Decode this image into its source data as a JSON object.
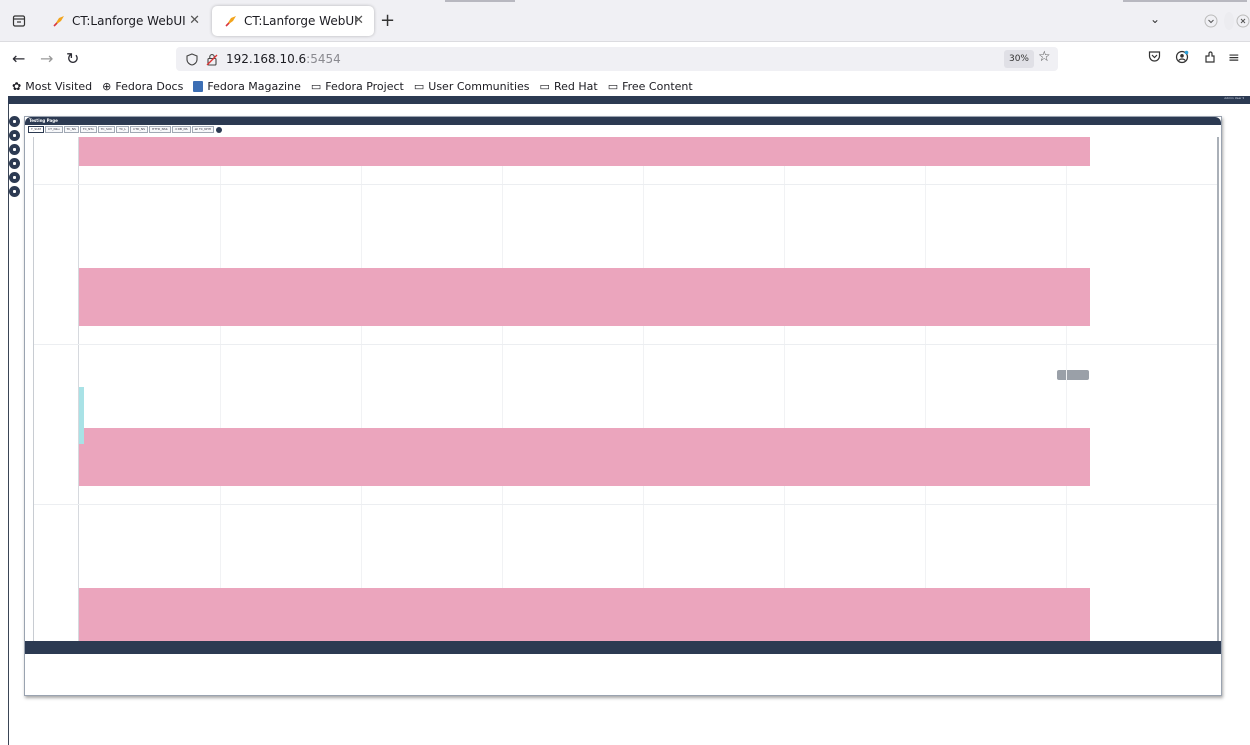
{
  "browser": {
    "tabs": [
      {
        "title": "CT:Lanforge WebUI",
        "active": false
      },
      {
        "title": "CT:Lanforge WebUI",
        "active": true
      }
    ],
    "new_tab": "+",
    "url_host": "192.168.10.6",
    "url_port": ":5454",
    "zoom": "30%",
    "bookmarks": [
      {
        "label": "Most Visited",
        "icon": "gear-icon"
      },
      {
        "label": "Fedora Docs",
        "icon": "globe-icon"
      },
      {
        "label": "Fedora Magazine",
        "icon": "magazine-icon"
      },
      {
        "label": "Fedora Project",
        "icon": "folder-icon"
      },
      {
        "label": "User Communities",
        "icon": "folder-icon"
      },
      {
        "label": "Red Hat",
        "icon": "folder-icon"
      },
      {
        "label": "Free Content",
        "icon": "folder-icon"
      }
    ]
  },
  "page": {
    "user_label": "Admin User ▾",
    "panel_title": "Testing Page",
    "subtabs": [
      "T_SUM",
      "CT_Nbu",
      "TC_NS",
      "TC_NTu",
      "TC_SUC",
      "TC_L",
      "CTD_NS",
      "HTTD_NSb",
      "d DB_NS",
      "all TC_NHH"
    ],
    "tooltip_lines": [
      "",
      ""
    ],
    "footer_text": "",
    "colors": {
      "navy": "#2c3a52",
      "bar_pink": "#eba5bd",
      "teal": "#a9e2e6"
    }
  },
  "chart_data": {
    "type": "bar",
    "orientation": "horizontal",
    "categories": [
      "",
      "",
      "",
      ""
    ],
    "values": [
      1,
      1,
      1,
      1
    ],
    "bar_labels": [
      "",
      "",
      "",
      ""
    ],
    "tick_labels": [
      "",
      "",
      ""
    ],
    "title": "",
    "xlabel": "",
    "ylabel": ""
  }
}
